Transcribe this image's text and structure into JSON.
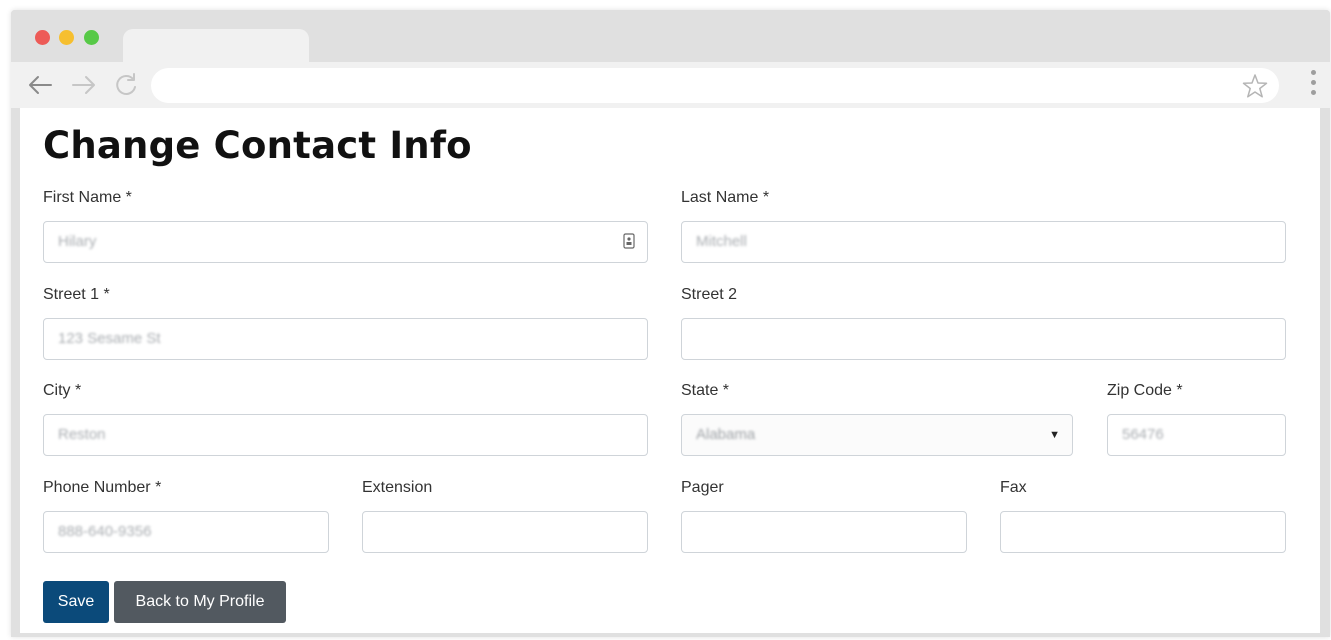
{
  "browser": {
    "icons": {
      "back": "arrow-left-icon",
      "forward": "arrow-right-icon",
      "reload": "reload-icon",
      "bookmark": "star-icon",
      "menu": "kebab-menu-icon"
    },
    "url": "",
    "colors": {
      "close": "#ed5b57",
      "minimize": "#f6bf2f",
      "maximize": "#57c947"
    }
  },
  "page": {
    "title": "Change Contact Info"
  },
  "form": {
    "first_name": {
      "label": "First Name *",
      "value": "Hilary"
    },
    "last_name": {
      "label": "Last Name *",
      "value": "Mitchell"
    },
    "street1": {
      "label": "Street 1 *",
      "value": "123 Sesame St"
    },
    "street2": {
      "label": "Street 2",
      "value": ""
    },
    "city": {
      "label": "City *",
      "value": "Reston"
    },
    "state": {
      "label": "State *",
      "value": "Alabama"
    },
    "zip": {
      "label": "Zip Code *",
      "value": "56476"
    },
    "phone": {
      "label": "Phone Number *",
      "value": "888-640-9356"
    },
    "extension": {
      "label": "Extension",
      "value": ""
    },
    "pager": {
      "label": "Pager",
      "value": ""
    },
    "fax": {
      "label": "Fax",
      "value": ""
    }
  },
  "actions": {
    "save_label": "Save",
    "back_label": "Back to My Profile",
    "save_color": "#0b4a7a",
    "back_color": "#525960"
  }
}
